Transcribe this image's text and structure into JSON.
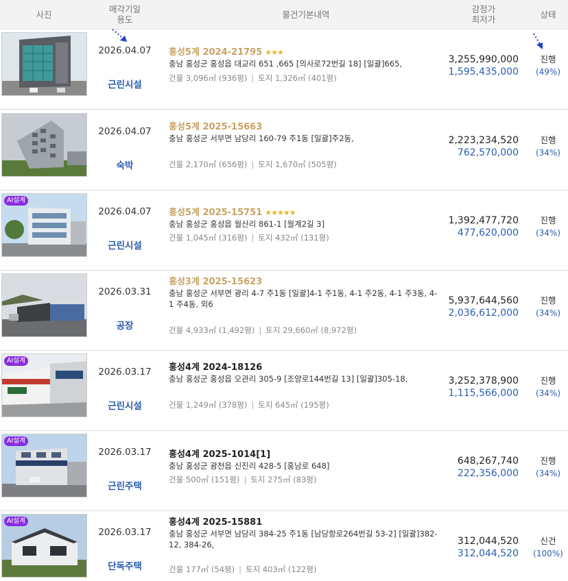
{
  "header": {
    "photo": "사진",
    "date_line1": "매각기일",
    "date_line2": "용도",
    "info": "물건기본내역",
    "price_line1": "감정가",
    "price_line2": "최저가",
    "status": "상태"
  },
  "colors": {
    "accent_blue": "#2a5db0",
    "gold": "#c9a264",
    "badge_purple": "#8a2be2"
  },
  "rows": [
    {
      "date": "2026.04.07",
      "use": "근린시설",
      "case": "홍성5계 2024-21795",
      "stars": "★★★",
      "addr": "충남 홍성군 홍성읍 대교리 651 ,665 [의사로72번길 18]  [일괄]665,",
      "building": "건물 3,096㎡ (936평)",
      "land": "토지 1,326㎡ (401평)",
      "appraisal": "3,255,990,000",
      "minimum": "1,595,435,000",
      "status": "진행",
      "pct": "(49%)",
      "ai": ""
    },
    {
      "date": "2026.04.07",
      "use": "숙박",
      "case": "홍성5계 2025-15663",
      "stars": "",
      "addr": "충남 홍성군 서부면 남당리 160-79 주1동  [일괄]주2동,",
      "building": "건물 2,170㎡ (656평)",
      "land": "토지 1,670㎡ (505평)",
      "appraisal": "2,223,234,520",
      "minimum": "762,570,000",
      "status": "진행",
      "pct": "(34%)",
      "ai": ""
    },
    {
      "date": "2026.04.07",
      "use": "근린시설",
      "case": "홍성5계 2025-15751",
      "stars": "★★★★★",
      "addr": "충남 홍성군 홍성읍 월산리 861-1 [월계2길 3]",
      "building": "건물 1,045㎡ (316평)",
      "land": "토지 432㎡ (131평)",
      "appraisal": "1,392,477,720",
      "minimum": "477,620,000",
      "status": "진행",
      "pct": "(34%)",
      "ai": "AI설계"
    },
    {
      "date": "2026.03.31",
      "use": "공장",
      "case": "홍성3계 2025-15623",
      "stars": "",
      "addr": "충남 홍성군 서부면 광리 4-7 주1동  [일괄]4-1 주1동, 4-1 주2동, 4-1 주3동, 4-1 주4동, 외6",
      "building": "건물 4,933㎡ (1,492평)",
      "land": "토지 29,660㎡ (8,972평)",
      "appraisal": "5,937,644,560",
      "minimum": "2,036,612,000",
      "status": "진행",
      "pct": "(34%)",
      "ai": ""
    },
    {
      "date": "2026.03.17",
      "use": "근린시설",
      "case": "홍성4계 2024-18126",
      "stars": "",
      "addr": "충남 홍성군 홍성읍 오관리 305-9 [조양로144번길 13]  [일괄]305-18,",
      "building": "건물 1,249㎡ (378평)",
      "land": "토지 645㎡ (195평)",
      "appraisal": "3,252,378,900",
      "minimum": "1,115,566,000",
      "status": "진행",
      "pct": "(34%)",
      "ai": "AI설계"
    },
    {
      "date": "2026.03.17",
      "use": "근린주택",
      "case": "홍성4계 2025-1014[1]",
      "stars": "",
      "addr": "충남 홍성군 광천읍 신진리 428-5 [홍남로 648]",
      "building": "건물 500㎡ (151평)",
      "land": "토지 275㎡ (83평)",
      "appraisal": "648,267,740",
      "minimum": "222,356,000",
      "status": "진행",
      "pct": "(34%)",
      "ai": "AI설계"
    },
    {
      "date": "2026.03.17",
      "use": "단독주택",
      "case": "홍성4계 2025-15881",
      "stars": "",
      "addr": "충남 홍성군 서부면 남당리 384-25 주1동 [남당항로264번길 53-2]  [일괄]382-12, 384-26,",
      "building": "건물 177㎡ (54평)",
      "land": "토지 403㎡ (122평)",
      "appraisal": "312,044,520",
      "minimum": "312,044,520",
      "status": "신건",
      "pct": "(100%)",
      "ai": "AI설계"
    }
  ]
}
